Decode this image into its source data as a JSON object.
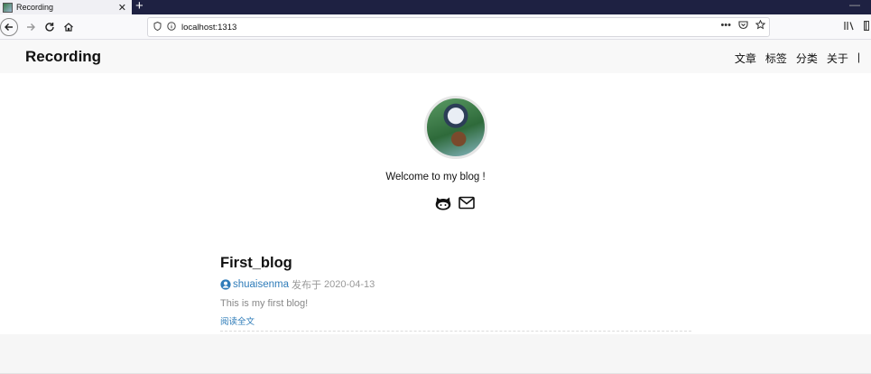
{
  "browser": {
    "tab_title": "Recording",
    "tab_close": "✕",
    "new_tab": "+",
    "url": "localhost:1313",
    "page_actions": "•••"
  },
  "site": {
    "title": "Recording",
    "nav": [
      "文章",
      "标签",
      "分类",
      "关于",
      "|"
    ]
  },
  "hero": {
    "welcome": "Welcome to my blog !",
    "social_icons": [
      "github-icon",
      "mail-icon"
    ]
  },
  "post": {
    "title": "First_blog",
    "author": "shuaisenma",
    "date_prefix": "发布于",
    "date": "2020-04-13",
    "summary": "This is my first blog!",
    "read_more": "阅读全文"
  },
  "colors": {
    "link": "#2f7cb9",
    "tabstrip": "#1e2142",
    "header_bg": "#f8f8f8"
  }
}
